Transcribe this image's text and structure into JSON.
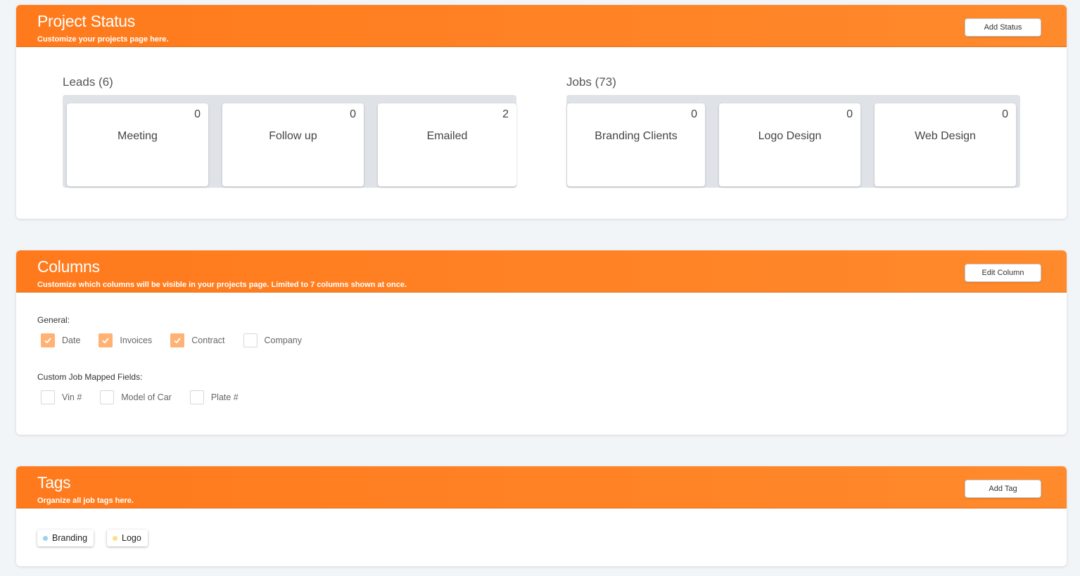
{
  "project_status": {
    "title": "Project Status",
    "subtitle": "Customize your projects page here.",
    "button_label": "Add Status",
    "leads": {
      "label": "Leads (6)",
      "cards": [
        {
          "name": "Meeting",
          "count": "0"
        },
        {
          "name": "Follow up",
          "count": "0"
        },
        {
          "name": "Emailed",
          "count": "2"
        }
      ]
    },
    "jobs": {
      "label": "Jobs (73)",
      "cards": [
        {
          "name": "Branding Clients",
          "count": "0"
        },
        {
          "name": "Logo Design",
          "count": "0"
        },
        {
          "name": "Web Design",
          "count": "0"
        }
      ]
    }
  },
  "columns": {
    "title": "Columns",
    "subtitle": "Customize which columns will be visible in your projects page. Limited to 7 columns shown at once.",
    "button_label": "Edit Column",
    "general_label": "General:",
    "general": [
      {
        "label": "Date",
        "checked": true
      },
      {
        "label": "Invoices",
        "checked": true
      },
      {
        "label": "Contract",
        "checked": true
      },
      {
        "label": "Company",
        "checked": false
      }
    ],
    "custom_label": "Custom Job Mapped Fields:",
    "custom": [
      {
        "label": "Vin #",
        "checked": false
      },
      {
        "label": "Model of Car",
        "checked": false
      },
      {
        "label": "Plate #",
        "checked": false
      }
    ]
  },
  "tags": {
    "title": "Tags",
    "subtitle": "Organize all job tags here.",
    "button_label": "Add Tag",
    "items": [
      {
        "label": "Branding",
        "color": "#9fd0ec"
      },
      {
        "label": "Logo",
        "color": "#f8e08c"
      }
    ]
  },
  "colors": {
    "accent": "#ff7f22",
    "checkbox_checked": "#ffb273",
    "page_bg": "#f2f5f8"
  }
}
